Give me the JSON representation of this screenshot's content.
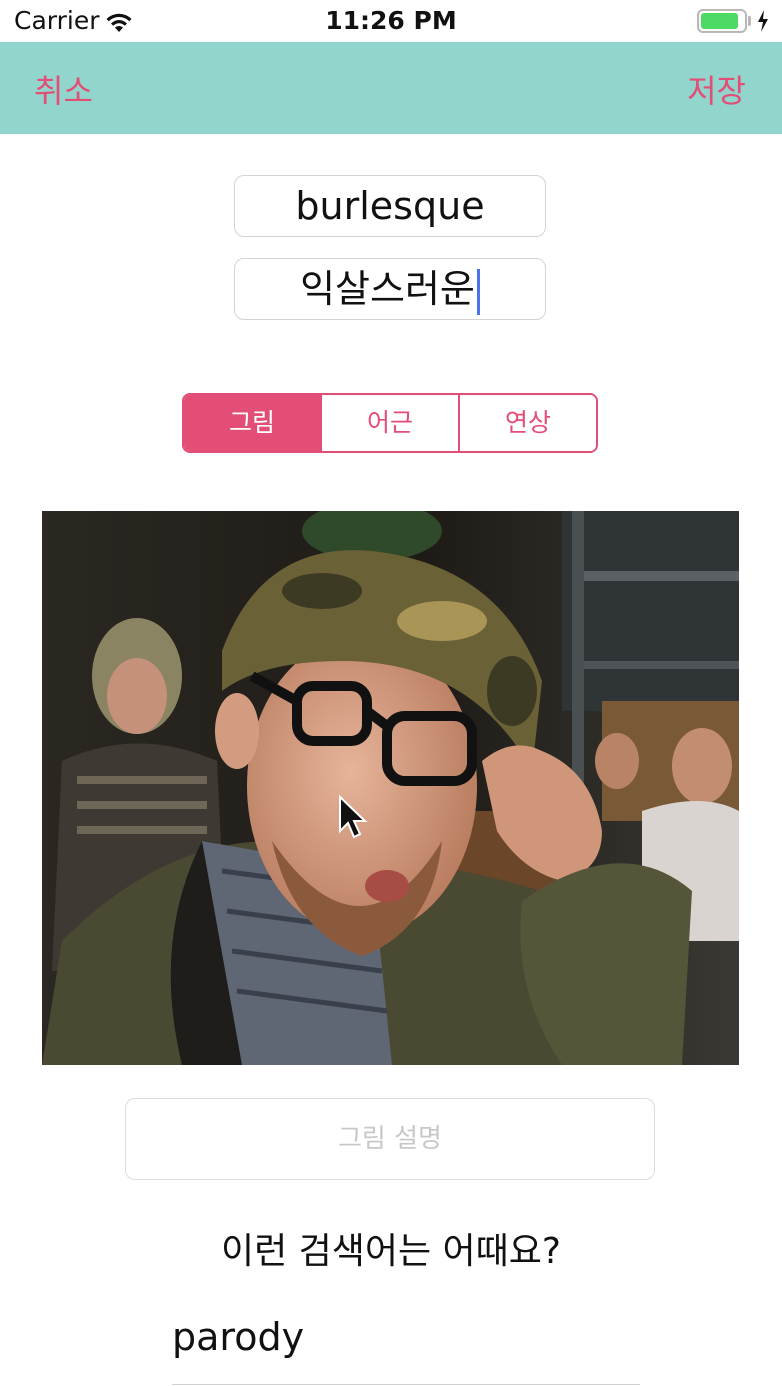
{
  "status_bar": {
    "carrier": "Carrier",
    "time": "11:26 PM",
    "battery_level": 0.9,
    "battery_color": "#4cd964"
  },
  "nav": {
    "cancel_label": "취소",
    "save_label": "저장",
    "background": "#92d5cc",
    "accent": "#e24e76"
  },
  "word": {
    "english": "burlesque",
    "korean": "익살스러운"
  },
  "segments": {
    "items": [
      "그림",
      "어근",
      "연상"
    ],
    "selected_index": 0
  },
  "photo": {
    "icon": "photo-image"
  },
  "description": {
    "placeholder": "그림 설명",
    "value": ""
  },
  "suggestions": {
    "heading": "이런 검색어는 어때요?",
    "items": [
      "parody"
    ]
  }
}
